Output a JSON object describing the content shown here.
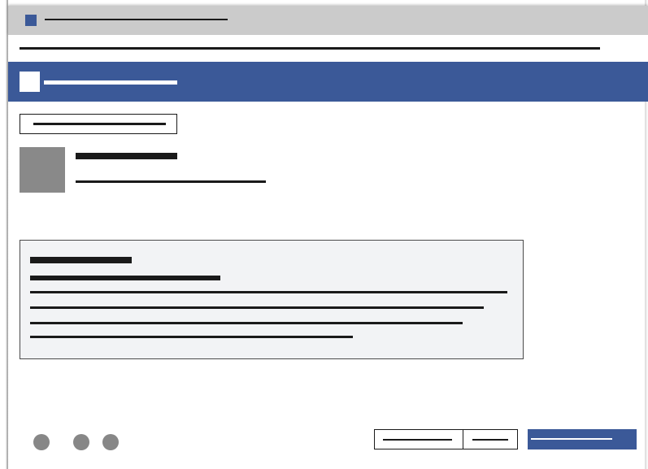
{
  "window": {
    "title": "",
    "icon": "app-icon"
  },
  "address_bar": {
    "url": ""
  },
  "header": {
    "logo": "logo-icon",
    "title": "",
    "brand_color": "#3b5998"
  },
  "main": {
    "back_button_label": "",
    "profile": {
      "name": "",
      "subtitle": ""
    },
    "info_box": {
      "heading": "",
      "subheading": "",
      "body_lines": [
        "",
        "",
        "",
        ""
      ]
    }
  },
  "footer": {
    "dots": [
      "",
      "",
      ""
    ],
    "secondary_buttons": [
      "",
      ""
    ],
    "primary_button_label": ""
  },
  "colors": {
    "accent": "#3b5998",
    "titlebar": "#cbcbcb",
    "panel": "#f2f3f5",
    "avatar": "#898989"
  }
}
